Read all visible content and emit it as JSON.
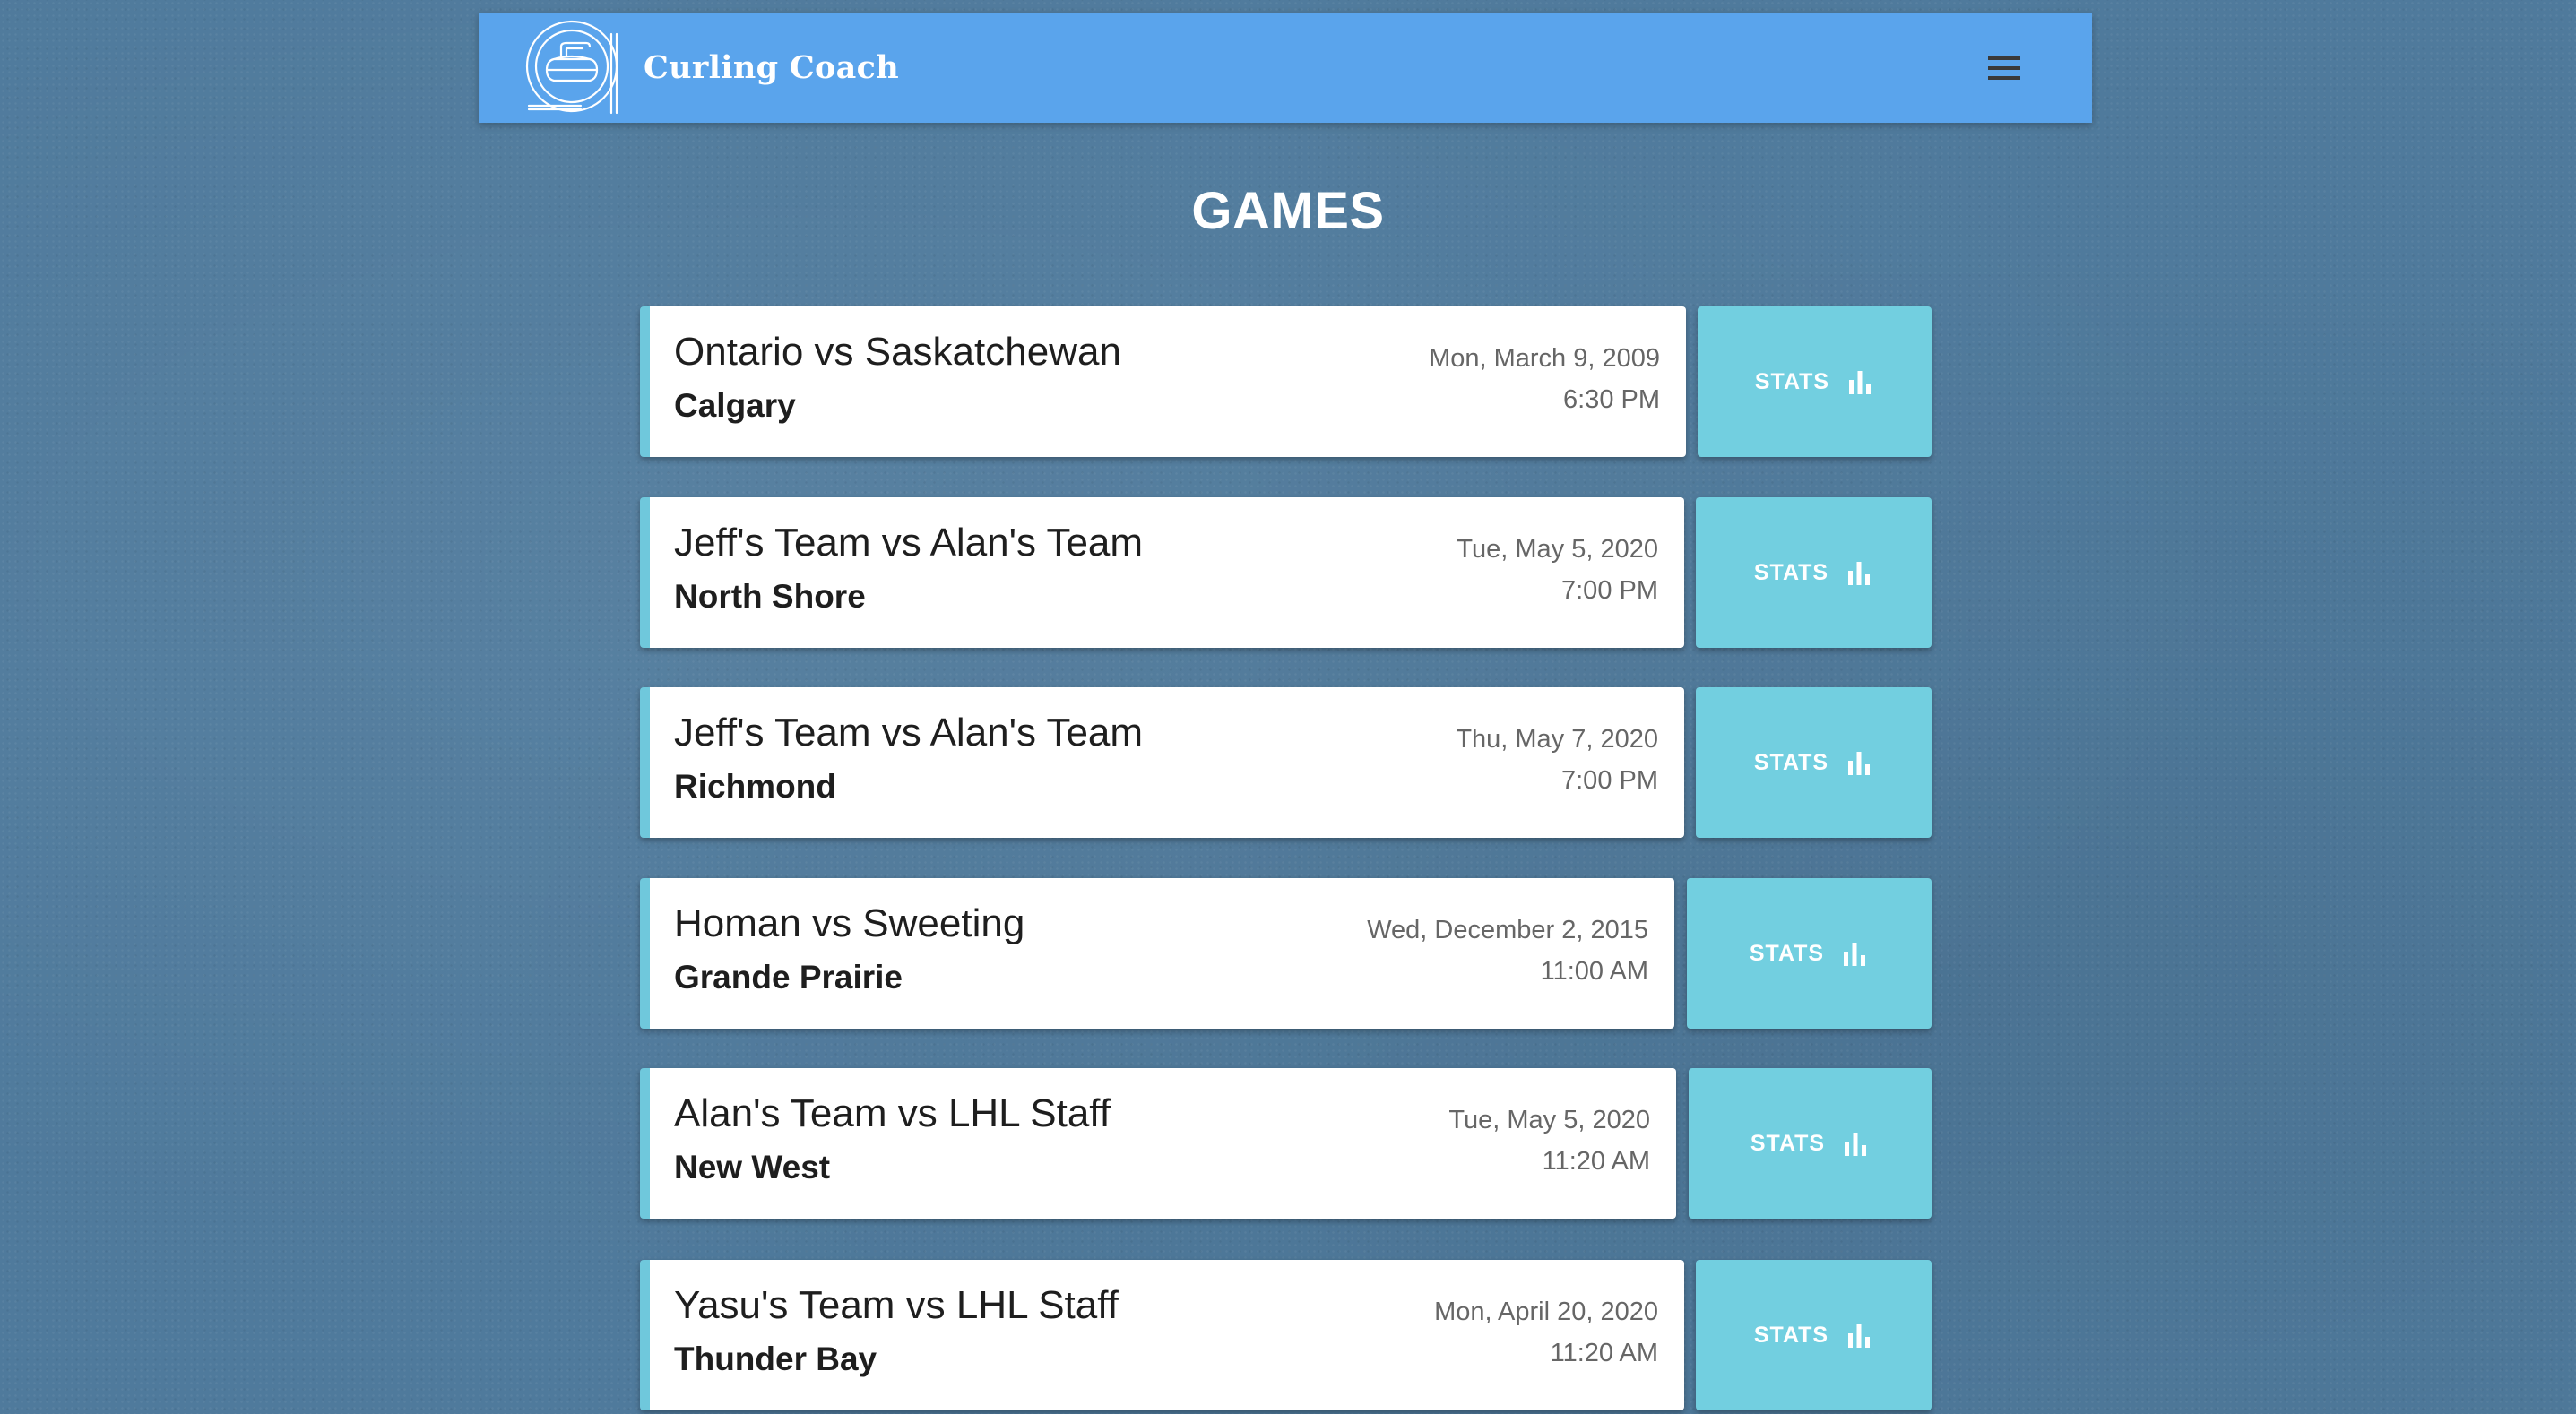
{
  "app": {
    "name": "Curling Coach",
    "logo_icon": "curling-stone-icon",
    "menu_icon": "hamburger-menu-icon"
  },
  "page": {
    "title": "GAMES"
  },
  "games": [
    {
      "matchup": "Ontario vs Saskatchewan",
      "location": "Calgary",
      "date": "Mon, March 9, 2009",
      "time": "6:30 PM",
      "stats_label": "STATS"
    },
    {
      "matchup": "Jeff's Team vs Alan's Team",
      "location": "North Shore",
      "date": "Tue, May 5, 2020",
      "time": "7:00 PM",
      "stats_label": "STATS"
    },
    {
      "matchup": "Jeff's Team vs Alan's Team",
      "location": "Richmond",
      "date": "Thu, May 7, 2020",
      "time": "7:00 PM",
      "stats_label": "STATS"
    },
    {
      "matchup": "Homan vs Sweeting",
      "location": "Grande Prairie",
      "date": "Wed, December 2, 2015",
      "time": "11:00 AM",
      "stats_label": "STATS"
    },
    {
      "matchup": "Alan's Team vs LHL Staff",
      "location": "New West",
      "date": "Tue, May 5, 2020",
      "time": "11:20 AM",
      "stats_label": "STATS"
    },
    {
      "matchup": "Yasu's Team vs LHL Staff",
      "location": "Thunder Bay",
      "date": "Mon, April 20, 2020",
      "time": "11:20 AM",
      "stats_label": "STATS"
    }
  ],
  "colors": {
    "background": "#4f7a9c",
    "navbar": "#5aa4ec",
    "card_accent": "#6fc8dc",
    "stats_button": "#72cfe0",
    "card": "#ffffff"
  },
  "stats_icon": "bar-chart-icon"
}
